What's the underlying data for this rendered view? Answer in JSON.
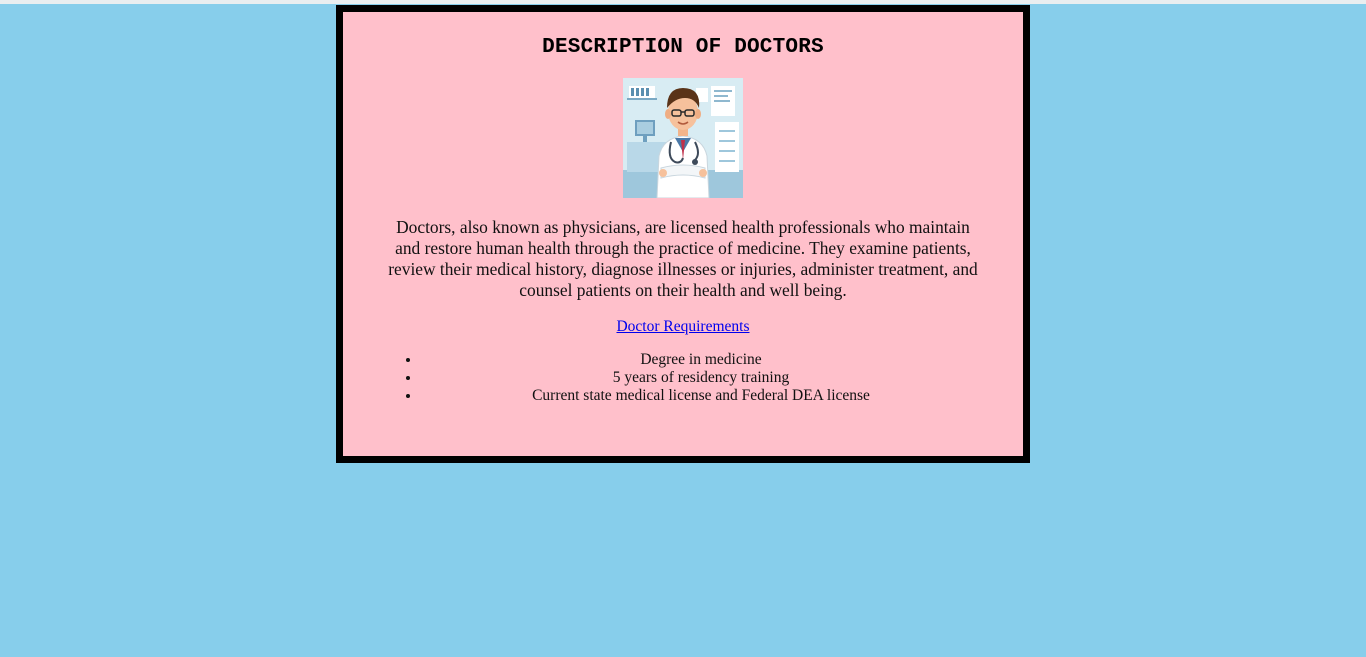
{
  "page": {
    "background": "#87CEEB",
    "card_background": "#FFC0CB",
    "border_color": "#000000",
    "link_color": "#0000EE"
  },
  "card": {
    "title": "DESCRIPTION OF DOCTORS",
    "image_icon": "doctor-portrait-icon",
    "description": "Doctors, also known as physicians, are licensed health professionals who maintain and restore human health through the practice of medicine. They examine patients, review their medical history, diagnose illnesses or injuries, administer treatment, and counsel patients on their health and well being.",
    "link_label": "Doctor Requirements",
    "requirements": [
      "Degree in medicine",
      "5 years of residency training",
      "Current state medical license and Federal DEA license"
    ]
  }
}
